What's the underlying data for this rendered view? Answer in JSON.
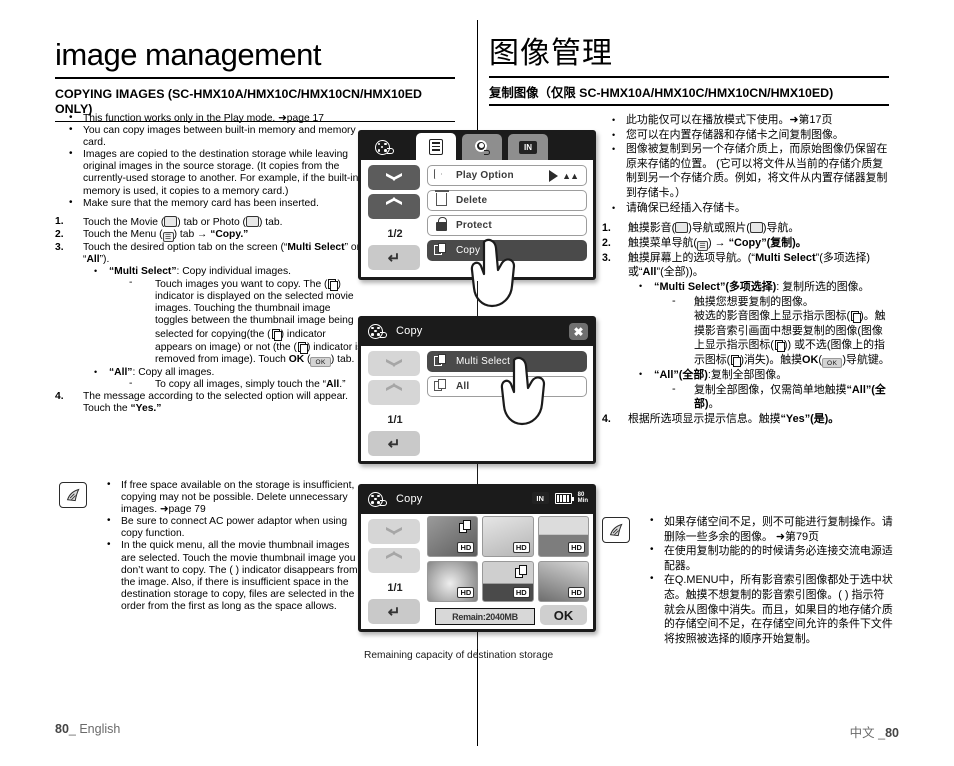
{
  "english": {
    "title": "image management",
    "section": "COPYING IMAGES (SC-HMX10A/HMX10C/HMX10CN/HMX10ED ONLY)",
    "bullets": [
      "This function works only in the Play mode. ➜page 17",
      "You can copy images between built-in memory and memory card.",
      "Images are copied to the destination storage while leaving original images in the source storage. (It copies from the currently-used storage to another. For example, if the built-in memory is used, it copies to a memory card.)",
      "Make sure that the memory card has been inserted."
    ],
    "step1_a": "Touch the Movie (",
    "step1_b": ") tab or Photo (",
    "step1_c": ") tab.",
    "step2_a": "Touch the Menu (",
    "step2_b": ") tab → ",
    "step2_bold": "“Copy.”",
    "step3_a": "Touch the desired option tab on the screen (“",
    "step3_bold1": "Multi Select",
    "step3_b": "” or “",
    "step3_bold2": "All",
    "step3_c": "”).",
    "step3_sub1_bold": "“Multi Select”",
    "step3_sub1_rest": ": Copy individual images.",
    "step3_sub1_dash_1": "Touch images you want to copy. The (",
    "step3_sub1_dash_2": ") indicator is displayed on the selected movie images. Touching the thumbnail image toggles between the thumbnail image being selected for copying(the (",
    "step3_sub1_dash_3": ") indicator appears on image) or not (the (",
    "step3_sub1_dash_4": ") indicator is removed from image). Touch ",
    "step3_sub1_ok": "OK",
    "step3_sub1_dash_5": " (",
    "step3_sub1_dash_6": ") tab.",
    "step3_sub2_bold": "“All”",
    "step3_sub2_rest": ": Copy all images.",
    "step3_sub2_dash": "To copy all images, simply touch the “",
    "step3_sub2_dash_bold": "All",
    "step3_sub2_dash_end": ".”",
    "step4_a": "The message according to the selected option will appear. Touch the ",
    "step4_bold": "“Yes.”",
    "notes": [
      "If free space available on the storage is insufficient, copying may not be possible. Delete unnecessary images. ➜page 79",
      "Be sure to connect AC power adaptor when using copy function.",
      "In the quick menu, all the movie thumbnail images are selected. Touch the movie thumbnail image you don’t want to copy. The ( ) indicator disappears from the image. Also, if there is insufficient space in the destination storage to copy, files are selected in the order from the first as long as the space allows."
    ],
    "caption": "Remaining capacity of destination storage",
    "footer_num": "80",
    "footer_lang": "English"
  },
  "chinese": {
    "title": "图像管理",
    "section": "复制图像（仅限 SC-HMX10A/HMX10C/HMX10CN/HMX10ED)",
    "bullets": [
      "此功能仅可以在播放模式下使用。➜第17页",
      "您可以在内置存储器和存储卡之间复制图像。",
      "图像被复制到另一个存储介质上，而原始图像仍保留在原来存储的位置。 (它可以将文件从当前的存储介质复制到另一个存储介质。例如，将文件从内置存储器复制到存储卡。）",
      "请确保已经插入存储卡。"
    ],
    "step1_a": "触摸影音(",
    "step1_b": ")导航或照片(",
    "step1_c": ")导航。",
    "step2_a": "触摸菜单导航(",
    "step2_b": ") → ",
    "step2_bold": "“Copy”(复制)。",
    "step3_a": "触摸屏幕上的选项导航。(“",
    "step3_bold1": "Multi Select",
    "step3_b1": "”(多项选择)或“",
    "step3_bold2": "All",
    "step3_b2": "”(全部))。",
    "step3_sub1_bold": "“Multi Select”(多项选择)",
    "step3_sub1_rest": ": 复制所选的图像。",
    "step3_sub1_dash_1": "触摸您想要复制的图像。",
    "step3_sub1_dash_2": "被选的影音图像上显示指示图标(",
    "step3_sub1_dash_3": ")。触摸影音索引画面中想要复制的图像(图像上显示指示图标(",
    "step3_sub1_dash_4": ")) 或不选(图像上的指示图标(",
    "step3_sub1_dash_5": ")消失)。触摸",
    "step3_sub1_ok": "OK",
    "step3_sub1_dash_6": "(",
    "step3_sub1_dash_7": ")导航键。",
    "step3_sub2_bold": "“All”(全部)",
    "step3_sub2_rest": ":复制全部图像。",
    "step3_sub2_dash": "复制全部图像，仅需简单地触摸",
    "step3_sub2_dash_bold": "“All”(全部)",
    "step3_sub2_dash_end": "。",
    "step4_a": "根据所选项显示提示信息。触摸",
    "step4_bold": "“Yes”(是)。",
    "notes": [
      "如果存储空间不足，则不可能进行复制操作。请删除一些多余的图像。 ➜第79页",
      "在使用复制功能的的时候请务必连接交流电源适配器。",
      "在Q.MENU中，所有影音索引图像都处于选中状态。触摸不想复制的影音索引图像。( ) 指示符就会从图像中消失。而且，如果目的地存储介质的存储空间不足，在存储空间允许的条件下文件将按照被选择的顺序开始复制。"
    ],
    "footer_lang": "中文",
    "footer_num": "80"
  },
  "screen1": {
    "tabs": [
      {
        "name": "movie-tab",
        "icon": "film-reel-icon",
        "active": false
      },
      {
        "name": "menu-tab",
        "icon": "list-icon",
        "active": true
      },
      {
        "name": "settings-tab",
        "icon": "gear-icon",
        "active": false
      },
      {
        "name": "storage-tab",
        "icon": "in-storage-icon",
        "label": "IN",
        "active": false
      }
    ],
    "page_indicator": "1/2",
    "menu_items": [
      {
        "label": "Play Option",
        "icon": "play-option-icon",
        "selected": false,
        "right": "▶"
      },
      {
        "label": "Delete",
        "icon": "trash-icon",
        "selected": false
      },
      {
        "label": "Protect",
        "icon": "lock-icon",
        "selected": false
      },
      {
        "label": "Copy",
        "icon": "copy-icon",
        "selected": true
      }
    ]
  },
  "screen2": {
    "title": "Copy",
    "page_indicator": "1/1",
    "close_label": "✖",
    "options": [
      {
        "label": "Multi Select",
        "icon": "multi-select-icon",
        "selected": true
      },
      {
        "label": "All",
        "icon": "all-copy-icon",
        "selected": false
      }
    ]
  },
  "screen3": {
    "title": "Copy",
    "page_indicator": "1/1",
    "status": {
      "storage": "IN",
      "battery_minutes": "80",
      "battery_unit": "Min"
    },
    "thumbnails": [
      {
        "hd": "HD",
        "marked": true
      },
      {
        "hd": "HD",
        "marked": false
      },
      {
        "hd": "HD",
        "marked": false
      },
      {
        "hd": "HD",
        "marked": false
      },
      {
        "hd": "HD",
        "marked": true
      },
      {
        "hd": "HD",
        "marked": false
      }
    ],
    "remain_label": "Remain:2040MB",
    "ok_label": "OK"
  }
}
